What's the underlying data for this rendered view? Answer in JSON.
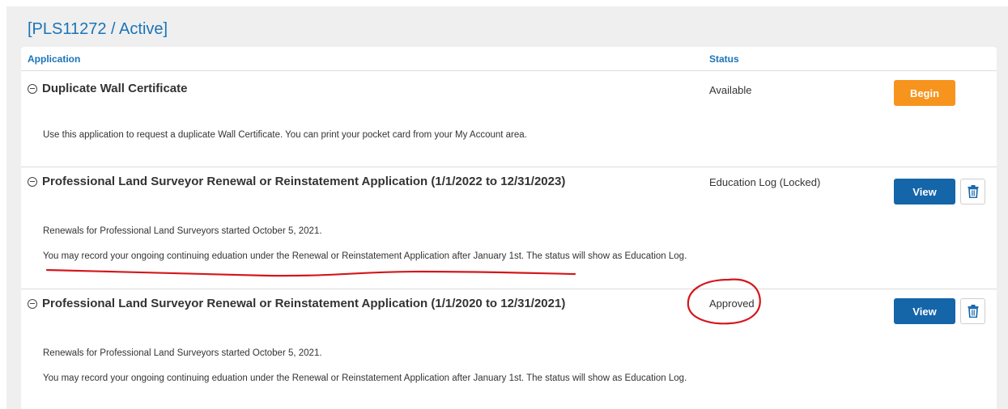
{
  "license": {
    "title": "[PLS11272 / Active]"
  },
  "table": {
    "col_application": "Application",
    "col_status": "Status"
  },
  "rows": [
    {
      "title": "Duplicate Wall Certificate",
      "status": "Available",
      "action_label": "Begin",
      "descriptions": [
        "Use this application to request a duplicate Wall Certificate. You can print your pocket card from your My Account area."
      ]
    },
    {
      "title": "Professional Land Surveyor Renewal or Reinstatement Application (1/1/2022 to 12/31/2023)",
      "status": "Education Log (Locked)",
      "action_label": "View",
      "descriptions": [
        "Renewals for Professional Land Surveyors started October 5, 2021.",
        "You may record your ongoing continuing eduation under the Renewal or Reinstatement Application after January 1st. The status will show as Education Log."
      ]
    },
    {
      "title": "Professional Land Surveyor Renewal or Reinstatement Application (1/1/2020 to 12/31/2021)",
      "status": "Approved",
      "action_label": "View",
      "descriptions": [
        "Renewals for Professional Land Surveyors started October 5, 2021.",
        "You may record your ongoing continuing eduation under the Renewal or Reinstatement Application after January 1st. The status will show as Education Log."
      ]
    }
  ],
  "colors": {
    "accent": "#1a74b8",
    "begin_button": "#f7941d",
    "view_button": "#1565a9",
    "annotation": "#d4171c"
  },
  "icons": {
    "collapse": "minus-circle-icon",
    "delete": "trash-icon"
  }
}
